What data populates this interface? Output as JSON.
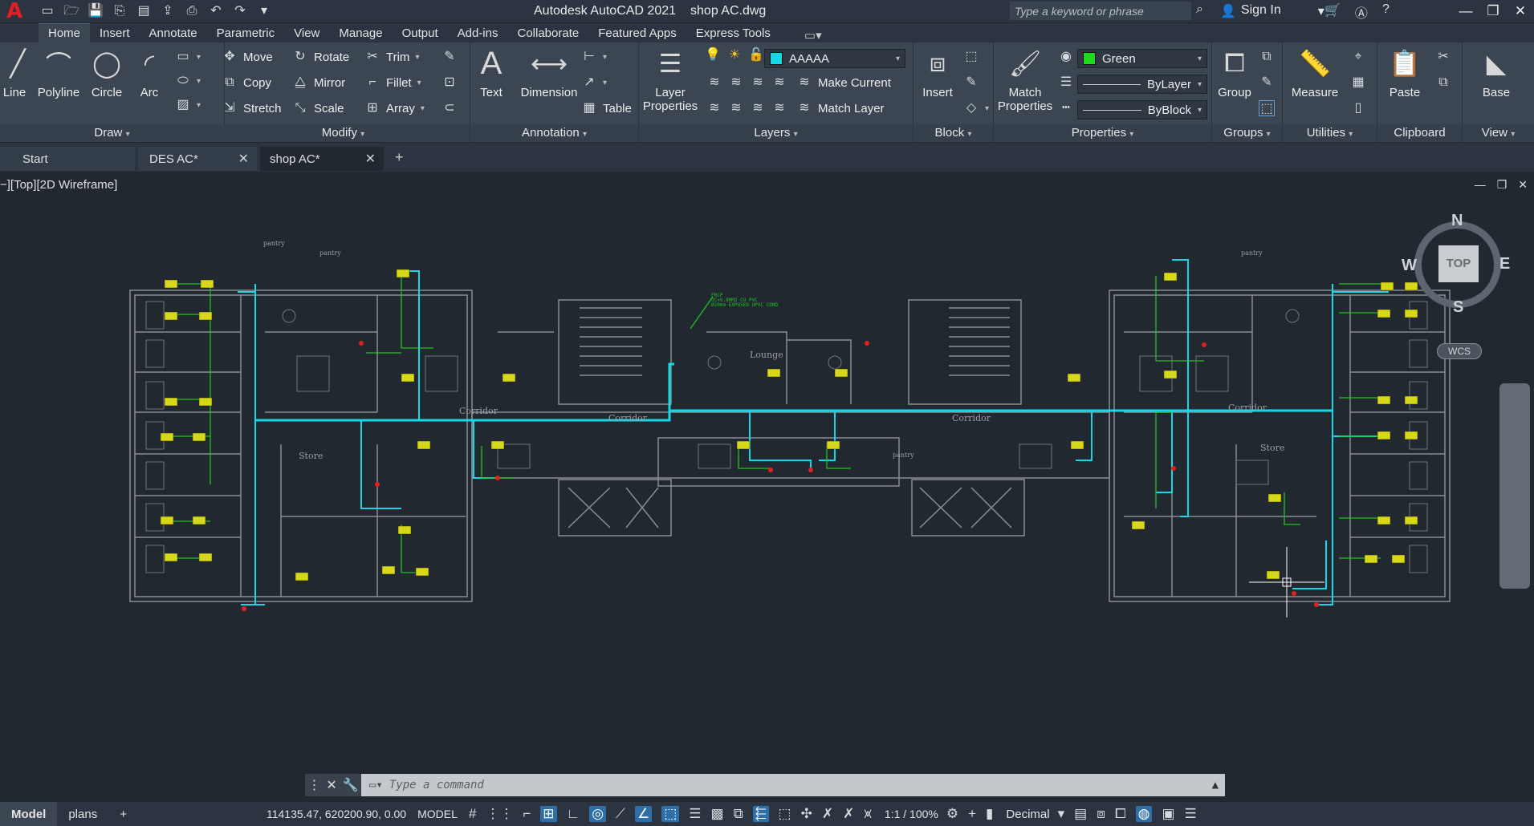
{
  "app": {
    "name": "Autodesk AutoCAD 2021",
    "document": "shop AC.dwg"
  },
  "titlebar": {
    "search_placeholder": "Type a keyword or phrase",
    "sign_in": "Sign In"
  },
  "ribbon_tabs": [
    "Home",
    "Insert",
    "Annotate",
    "Parametric",
    "View",
    "Manage",
    "Output",
    "Add-ins",
    "Collaborate",
    "Featured Apps",
    "Express Tools"
  ],
  "panels": {
    "draw": {
      "label": "Draw",
      "line": "Line",
      "polyline": "Polyline",
      "circle": "Circle",
      "arc": "Arc"
    },
    "modify": {
      "label": "Modify",
      "move": "Move",
      "rotate": "Rotate",
      "trim": "Trim",
      "copy": "Copy",
      "mirror": "Mirror",
      "fillet": "Fillet",
      "stretch": "Stretch",
      "scale": "Scale",
      "array": "Array"
    },
    "annotation": {
      "label": "Annotation",
      "text": "Text",
      "dimension": "Dimension",
      "table": "Table"
    },
    "layers": {
      "label": "Layers",
      "layer_properties": "Layer Properties",
      "current_layer": "AAAAA",
      "make_current": "Make Current",
      "match_layer": "Match Layer"
    },
    "block": {
      "label": "Block",
      "insert": "Insert"
    },
    "properties": {
      "label": "Properties",
      "match_properties": "Match Properties",
      "color": "Green",
      "linetype": "ByLayer",
      "lineweight": "ByBlock"
    },
    "groups": {
      "label": "Groups",
      "group": "Group"
    },
    "utilities": {
      "label": "Utilities",
      "measure": "Measure"
    },
    "clipboard": {
      "label": "Clipboard",
      "paste": "Paste"
    },
    "view": {
      "label": "View",
      "base": "Base"
    }
  },
  "file_tabs": [
    {
      "label": "Start"
    },
    {
      "label": "DES AC*"
    },
    {
      "label": "shop AC*"
    }
  ],
  "viewport": {
    "label": "−][Top][2D Wireframe]",
    "viewcube": {
      "face": "TOP",
      "n": "N",
      "s": "S",
      "e": "E",
      "w": "W",
      "wcs": "WCS"
    },
    "room_labels": [
      "Corridor",
      "Corridor",
      "Corridor",
      "Corridor",
      "Store",
      "Store",
      "Lounge",
      "pantry",
      "pantry",
      "pantry",
      "pantry"
    ],
    "leader_note": [
      "FRCP",
      "3C×0.8MM2 CU PVC",
      "Ø20mm EXPOSED UPVC COND"
    ]
  },
  "command_line": {
    "placeholder": "Type a command"
  },
  "status": {
    "layout_tabs": [
      "Model",
      "plans"
    ],
    "coordinates": "114135.47, 620200.90, 0.00",
    "model_label": "MODEL",
    "scale": "1:1 / 100%",
    "units": "Decimal"
  },
  "colors": {
    "accent_cyan": "#16d8e6",
    "wiring_green": "#1fc21f",
    "fixture_yellow": "#d8d81a",
    "wall_gray": "#8a8e93",
    "point_red": "#e32020",
    "background": "#212830"
  }
}
